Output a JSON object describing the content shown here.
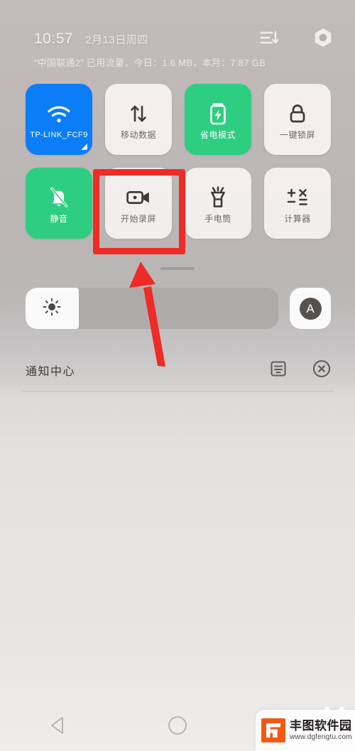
{
  "statusbar": {
    "time": "10:57",
    "date": "2月13日周四",
    "data_usage": "“中国联通2” 已用流量，今日：1.6 MB，本月：7.87 GB",
    "sort_icon": "sort-descending-icon",
    "settings_icon": "settings-gear-icon"
  },
  "quick_settings": {
    "tiles": [
      {
        "label": "TP-LINK_FCF9",
        "icon": "wifi-icon",
        "state": "on",
        "color": "#0b7ef7",
        "name": "wifi"
      },
      {
        "label": "移动数据",
        "icon": "mobile-data-icon",
        "state": "off",
        "color": "#f7f5f4",
        "name": "mobile-data"
      },
      {
        "label": "省电模式",
        "icon": "battery-saver-icon",
        "state": "on",
        "color": "#2ece82",
        "name": "power-saver"
      },
      {
        "label": "一键锁屏",
        "icon": "lock-icon",
        "state": "off",
        "color": "#f7f5f4",
        "name": "lock-screen"
      },
      {
        "label": "静音",
        "icon": "bell-muted-icon",
        "state": "on",
        "color": "#2ece82",
        "name": "silent-mode"
      },
      {
        "label": "开始录屏",
        "icon": "video-camera-icon",
        "state": "off",
        "color": "#f7f5f4",
        "name": "screen-record"
      },
      {
        "label": "手电筒",
        "icon": "flashlight-icon",
        "state": "off",
        "color": "#f7f5f4",
        "name": "flashlight"
      },
      {
        "label": "计算器",
        "icon": "calculator-icon",
        "state": "off",
        "color": "#f7f5f4",
        "name": "calculator"
      }
    ]
  },
  "brightness": {
    "icon": "brightness-sun-icon",
    "level_percent": 21,
    "auto_label": "A",
    "auto_icon": "auto-brightness-icon"
  },
  "notifications": {
    "title": "通知中心",
    "settings_icon": "notification-settings-icon",
    "clear_icon": "clear-all-icon"
  },
  "annotation": {
    "highlight_color": "#ee2b26",
    "arrow_color": "#ee2b26",
    "highlight_target": "开始录屏"
  },
  "navbar": {
    "back_icon": "back-triangle-icon",
    "home_icon": "home-circle-icon"
  },
  "watermark": {
    "name": "丰图软件园",
    "url": "www.dgfengtu.com",
    "logo_color": "#f05a14"
  }
}
